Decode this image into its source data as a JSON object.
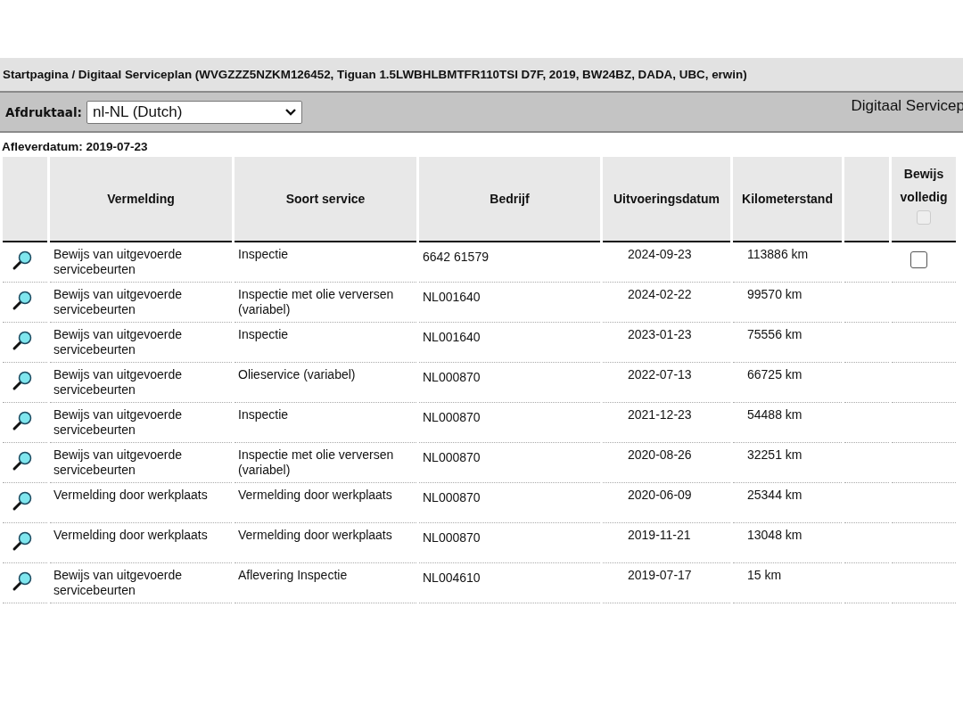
{
  "breadcrumb": "Startpagina / Digitaal Serviceplan (WVGZZZ5NZKM126452, Tiguan 1.5LWBHLBMTFR110TSI D7F, 2019, BW24BZ, DADA, UBC, erwin)",
  "toolbar": {
    "language_label": "Afdruktaal:",
    "language_value": "nl-NL (Dutch)",
    "title": "Digitaal Servicep"
  },
  "delivery_date": "Afleverdatum: 2019-07-23",
  "table": {
    "columns": [
      "Vermelding",
      "Soort service",
      "Bedrijf",
      "Uitvoeringsdatum",
      "Kilometerstand"
    ],
    "proof_column": {
      "label_1": "Bewijs",
      "label_2": "volledig",
      "checked": false,
      "disabled": true
    },
    "rows": [
      {
        "entry": "Bewijs van uitgevoerde servicebeurten",
        "service": "Inspectie",
        "company": "6642 61579",
        "date": "2024-09-23",
        "mileage": "113886 km",
        "proof": {
          "checked": false
        }
      },
      {
        "entry": "Bewijs van uitgevoerde servicebeurten",
        "service": "Inspectie met olie verversen (variabel)",
        "company": "NL001640",
        "date": "2024-02-22",
        "mileage": "99570 km"
      },
      {
        "entry": "Bewijs van uitgevoerde servicebeurten",
        "service": "Inspectie",
        "company": "NL001640",
        "date": "2023-01-23",
        "mileage": "75556 km"
      },
      {
        "entry": "Bewijs van uitgevoerde servicebeurten",
        "service": "Olieservice (variabel)",
        "company": "NL000870",
        "date": "2022-07-13",
        "mileage": "66725 km"
      },
      {
        "entry": "Bewijs van uitgevoerde servicebeurten",
        "service": "Inspectie",
        "company": "NL000870",
        "date": "2021-12-23",
        "mileage": "54488 km"
      },
      {
        "entry": "Bewijs van uitgevoerde servicebeurten",
        "service": "Inspectie met olie verversen (variabel)",
        "company": "NL000870",
        "date": "2020-08-26",
        "mileage": "32251 km"
      },
      {
        "entry": "Vermelding door werkplaats",
        "service": "Vermelding door werkplaats",
        "company": "NL000870",
        "date": "2020-06-09",
        "mileage": "25344 km"
      },
      {
        "entry": "Vermelding door werkplaats",
        "service": "Vermelding door werkplaats",
        "company": "NL000870",
        "date": "2019-11-21",
        "mileage": "13048 km"
      },
      {
        "entry": "Bewijs van uitgevoerde servicebeurten",
        "service": "Aflevering Inspectie",
        "company": "NL004610",
        "date": "2019-07-17",
        "mileage": "15 km"
      }
    ]
  }
}
